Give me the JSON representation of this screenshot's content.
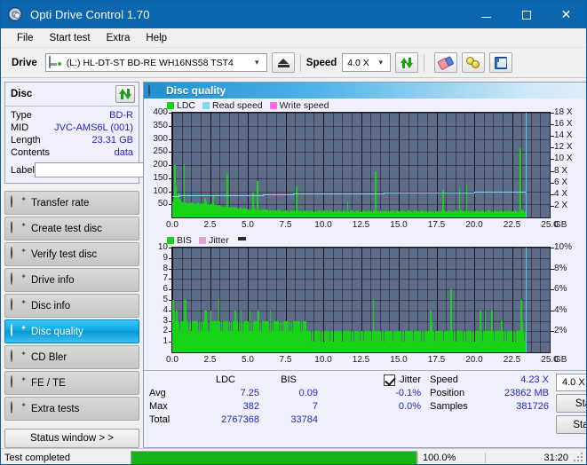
{
  "window": {
    "title": "Opti Drive Control 1.70",
    "minimize": "—",
    "maximize": "□",
    "close": "✕"
  },
  "menu": [
    "File",
    "Start test",
    "Extra",
    "Help"
  ],
  "toolbar": {
    "drive_label": "Drive",
    "drive_value": "(L:)  HL-DT-ST BD-RE  WH16NS58 TST4",
    "eject_title": "Eject",
    "speed_label": "Speed",
    "speed_value": "4.0 X",
    "refresh_title": "Refresh",
    "erase_title": "Erase",
    "gold_title": "Tools",
    "save_title": "Save"
  },
  "disc": {
    "header": "Disc",
    "refresh_icon": "refresh-icon",
    "rows": [
      {
        "key": "Type",
        "value": "BD-R"
      },
      {
        "key": "MID",
        "value": "JVC-AMS6L (001)"
      },
      {
        "key": "Length",
        "value": "23.31 GB"
      },
      {
        "key": "Contents",
        "value": "data"
      }
    ],
    "label_key": "Label",
    "label_value": "",
    "label_placeholder": ""
  },
  "nav": {
    "items": [
      {
        "label": "Transfer rate",
        "active": false
      },
      {
        "label": "Create test disc",
        "active": false
      },
      {
        "label": "Verify test disc",
        "active": false
      },
      {
        "label": "Drive info",
        "active": false
      },
      {
        "label": "Disc info",
        "active": false
      },
      {
        "label": "Disc quality",
        "active": true
      },
      {
        "label": "CD Bler",
        "active": false
      },
      {
        "label": "FE / TE",
        "active": false
      },
      {
        "label": "Extra tests",
        "active": false
      }
    ],
    "status_window": "Status window > >"
  },
  "panel": {
    "title": "Disc quality"
  },
  "stats": {
    "headers": {
      "c0": "",
      "ldc": "LDC",
      "bis": "BIS",
      "jitter": "Jitter"
    },
    "jitter_checked": true,
    "rows": [
      {
        "label": "Avg",
        "ldc": "7.25",
        "bis": "0.09",
        "jitter": "-0.1%"
      },
      {
        "label": "Max",
        "ldc": "382",
        "bis": "7",
        "jitter": "0.0%"
      },
      {
        "label": "Total",
        "ldc": "2767368",
        "bis": "33784",
        "jitter": ""
      }
    ],
    "right": [
      {
        "key": "Speed",
        "value": "4.23 X"
      },
      {
        "key": "Position",
        "value": "23862 MB"
      },
      {
        "key": "Samples",
        "value": "381726"
      }
    ],
    "speed_select": "4.0 X",
    "start_full": "Start full",
    "start_part": "Start part"
  },
  "statusbar": {
    "message": "Test completed",
    "progress_percent": "100.0%",
    "progress_value": 100,
    "elapsed": "31:20"
  },
  "colors": {
    "accent": "#0a66ae",
    "value_blue": "#2424c8",
    "ldc_green": "#17d217",
    "read_speed": "#7fd6f5",
    "write_speed": "#ff6ee8",
    "jitter": "#d9a8d9",
    "plot_bg": "#5d6c88",
    "progress_green": "#17b317"
  },
  "chart_data": [
    {
      "type": "area",
      "id": "ldc-chart",
      "title": "",
      "xlabel": "GB",
      "ylabel": "",
      "xlim": [
        0,
        25.0
      ],
      "ylim": [
        0,
        400
      ],
      "y2lim": [
        0,
        18
      ],
      "y2label": "X",
      "xticks": [
        "0.0",
        "2.5",
        "5.0",
        "7.5",
        "10.0",
        "12.5",
        "15.0",
        "17.5",
        "20.0",
        "22.5",
        "25.0"
      ],
      "yticks": [
        "50",
        "100",
        "150",
        "200",
        "250",
        "300",
        "350",
        "400"
      ],
      "y2ticks": [
        "2 X",
        "4 X",
        "6 X",
        "8 X",
        "10 X",
        "12 X",
        "14 X",
        "16 X",
        "18 X"
      ],
      "x_unit": "GB",
      "legend": [
        {
          "name": "LDC",
          "color": "#17d217"
        },
        {
          "name": "Read speed",
          "color": "#7fd6f5"
        },
        {
          "name": "Write speed",
          "color": "#ff6ee8"
        }
      ],
      "grid": true,
      "data_end_x": 23.4,
      "series": [
        {
          "name": "LDC",
          "color": "#17d217",
          "kind": "bars",
          "values": [
            62,
            70,
            200,
            120,
            75,
            90,
            70,
            66,
            62,
            58,
            60,
            203,
            58,
            55,
            52,
            54,
            56,
            55,
            58,
            52,
            54,
            52,
            50,
            55,
            58,
            52,
            50,
            55,
            52,
            50,
            55,
            76,
            60,
            50,
            52,
            48,
            50,
            52,
            58,
            85,
            52,
            48,
            50,
            46,
            45,
            48,
            44,
            42,
            45,
            40,
            42,
            38,
            40,
            168,
            42,
            38,
            40,
            36,
            38,
            34,
            36,
            38,
            40,
            35,
            34,
            36,
            38,
            30,
            34,
            36,
            32,
            30,
            34,
            32,
            30,
            28,
            32,
            30,
            95,
            34,
            30,
            28,
            140,
            32,
            28,
            26,
            30,
            28,
            30,
            26,
            28,
            30,
            26,
            24,
            28,
            26,
            24,
            28,
            26,
            24,
            26,
            28,
            24,
            26,
            30,
            24,
            22,
            26,
            24,
            22,
            26,
            24,
            26,
            22,
            24,
            26,
            24,
            22,
            26,
            24,
            120,
            26,
            24,
            22,
            26,
            24,
            22,
            26,
            24,
            22,
            24,
            26,
            22,
            24,
            22,
            26,
            24,
            22,
            24,
            26,
            22,
            24,
            22,
            26,
            24,
            22,
            26,
            24,
            22,
            24,
            26,
            22,
            24,
            26,
            22,
            24,
            22,
            26,
            24,
            22,
            24,
            22,
            26,
            24,
            22,
            24,
            26,
            22,
            24,
            22,
            60,
            24,
            22,
            24,
            26,
            22,
            24,
            22,
            24,
            26,
            22,
            24,
            22,
            24,
            22,
            26,
            24,
            22,
            24,
            22,
            26,
            24,
            22,
            24,
            22,
            24,
            26,
            175,
            24,
            22,
            24,
            22,
            26,
            24,
            22,
            24,
            22,
            24,
            26,
            22,
            24,
            22,
            24,
            22,
            26,
            24,
            22,
            24,
            26,
            22,
            24,
            22,
            24,
            26,
            22,
            24,
            22,
            24,
            22,
            26,
            24,
            22,
            24,
            22,
            24,
            26,
            22,
            24,
            22,
            24,
            22,
            24,
            26,
            22,
            24,
            22,
            24,
            26,
            22,
            24,
            22,
            24,
            22,
            26,
            24,
            22,
            24,
            22,
            24,
            26,
            22,
            24,
            22,
            105,
            26,
            22,
            24,
            22,
            24,
            26,
            22,
            24,
            22,
            24,
            22,
            26,
            24,
            22,
            24,
            110,
            26,
            22,
            24,
            22,
            24,
            26,
            130,
            24,
            22,
            24,
            22,
            26,
            24,
            22,
            24,
            22,
            26,
            24,
            22,
            24,
            22,
            24,
            26,
            22,
            24,
            22,
            24,
            26,
            22,
            24,
            22,
            24,
            22,
            26,
            24,
            22,
            24,
            22,
            24,
            26,
            22,
            24,
            22,
            24,
            26,
            22,
            24,
            22,
            26,
            24,
            22,
            24,
            22,
            24,
            26,
            22,
            24,
            22,
            265,
            30,
            26,
            24,
            22,
            24
          ]
        },
        {
          "name": "Read speed",
          "color": "#7fd6f5",
          "kind": "line",
          "axis": "right",
          "values_x_speed": [
            [
              0.0,
              3.5
            ],
            [
              0.4,
              3.6
            ],
            [
              2.0,
              3.65
            ],
            [
              4.0,
              3.7
            ],
            [
              6.0,
              3.8
            ],
            [
              8.0,
              3.9
            ],
            [
              10.0,
              4.0
            ],
            [
              12.0,
              4.05
            ],
            [
              14.0,
              4.1
            ],
            [
              16.0,
              4.15
            ],
            [
              18.0,
              4.2
            ],
            [
              20.0,
              4.25
            ],
            [
              22.0,
              4.3
            ],
            [
              23.4,
              4.3
            ]
          ]
        }
      ]
    },
    {
      "type": "area",
      "id": "bis-chart",
      "title": "",
      "xlabel": "GB",
      "ylabel": "",
      "xlim": [
        0,
        25.0
      ],
      "ylim": [
        0,
        10
      ],
      "y2lim": [
        0,
        10
      ],
      "y2label": "%",
      "xticks": [
        "0.0",
        "2.5",
        "5.0",
        "7.5",
        "10.0",
        "12.5",
        "15.0",
        "17.5",
        "20.0",
        "22.5",
        "25.0"
      ],
      "yticks": [
        "1",
        "2",
        "3",
        "4",
        "5",
        "6",
        "7",
        "8",
        "9",
        "10"
      ],
      "y2ticks": [
        "2%",
        "4%",
        "6%",
        "8%",
        "10%"
      ],
      "x_unit": "GB",
      "legend": [
        {
          "name": "BIS",
          "color": "#17d217"
        },
        {
          "name": "Jitter",
          "color": "#d9a8d9"
        }
      ],
      "grid": true,
      "data_end_x": 23.4,
      "series": [
        {
          "name": "BIS",
          "color": "#17d217",
          "kind": "bars",
          "values": [
            5,
            4,
            3,
            3,
            4,
            3,
            3,
            2,
            3,
            3,
            2,
            3,
            5,
            5,
            3,
            3,
            2,
            3,
            3,
            2,
            3,
            2,
            3,
            2,
            3,
            3,
            2,
            3,
            2,
            3,
            2,
            3,
            2,
            4,
            4,
            3,
            2,
            2,
            3,
            4,
            3,
            2,
            3,
            2,
            3,
            2,
            3,
            5,
            3,
            2,
            3,
            2,
            3,
            2,
            3,
            2,
            3,
            2,
            3,
            2,
            3,
            2,
            3,
            2,
            4,
            2,
            3,
            2,
            3,
            2,
            4,
            3,
            2,
            3,
            2,
            3,
            2,
            3,
            2,
            4,
            2,
            3,
            2,
            3,
            2,
            3,
            2,
            3,
            4,
            2,
            3,
            2,
            3,
            2,
            3,
            2,
            3,
            2,
            3,
            2,
            4,
            2,
            3,
            2,
            3,
            2,
            3,
            2,
            3,
            2,
            3,
            2,
            3,
            2,
            3,
            2,
            3,
            2,
            3,
            2,
            3,
            2,
            3,
            2,
            3,
            2,
            3,
            2,
            3,
            2,
            3,
            2,
            3,
            2,
            3,
            2,
            3,
            2,
            2,
            2,
            2,
            2,
            1,
            2,
            2,
            1,
            2,
            2,
            1,
            2,
            2,
            2,
            1,
            2,
            2,
            1,
            2,
            2,
            1,
            2,
            2,
            1,
            2,
            2,
            2,
            1,
            2,
            2,
            1,
            2,
            2,
            1,
            2,
            2,
            1,
            2,
            2,
            2,
            1,
            2,
            1,
            2,
            2,
            1,
            2,
            2,
            1,
            2,
            2,
            1,
            2,
            2,
            1,
            2,
            2,
            2,
            1,
            2,
            1,
            2,
            2,
            1,
            2,
            2,
            1,
            2,
            5,
            2,
            1,
            2,
            2,
            1,
            2,
            2,
            1,
            2,
            2,
            1,
            2,
            2,
            1,
            2,
            2,
            1,
            2,
            2,
            1,
            2,
            2,
            2,
            1,
            2,
            1,
            2,
            2,
            1,
            2,
            2,
            1,
            2,
            2,
            1,
            2,
            2,
            1,
            2,
            2,
            1,
            2,
            2,
            1,
            2,
            2,
            1,
            2,
            1,
            2,
            2,
            1,
            2,
            2,
            1,
            2,
            2,
            1,
            4,
            3,
            2,
            2,
            1,
            2,
            2,
            1,
            2,
            2,
            1,
            2,
            2,
            1,
            2,
            2,
            1,
            2,
            2,
            1,
            2,
            6,
            2,
            1,
            2,
            2,
            1,
            2,
            2,
            2,
            1,
            2,
            2,
            1,
            2,
            2,
            1,
            2,
            2,
            1,
            2,
            2,
            1,
            2,
            2,
            1,
            2,
            2,
            2,
            1,
            2,
            4,
            2,
            1,
            2,
            2,
            4,
            2,
            1,
            2,
            2,
            1,
            2,
            4,
            2,
            1,
            2,
            2,
            1,
            2,
            2,
            1,
            2,
            3,
            2,
            1,
            2,
            2,
            1,
            2,
            2,
            1,
            2,
            2,
            1,
            2,
            2,
            1,
            2,
            2,
            1,
            2,
            2,
            5,
            3,
            2,
            1,
            2
          ]
        },
        {
          "name": "Jitter",
          "color": "#d9a8d9",
          "kind": "line",
          "axis": "right",
          "values": []
        }
      ]
    }
  ]
}
